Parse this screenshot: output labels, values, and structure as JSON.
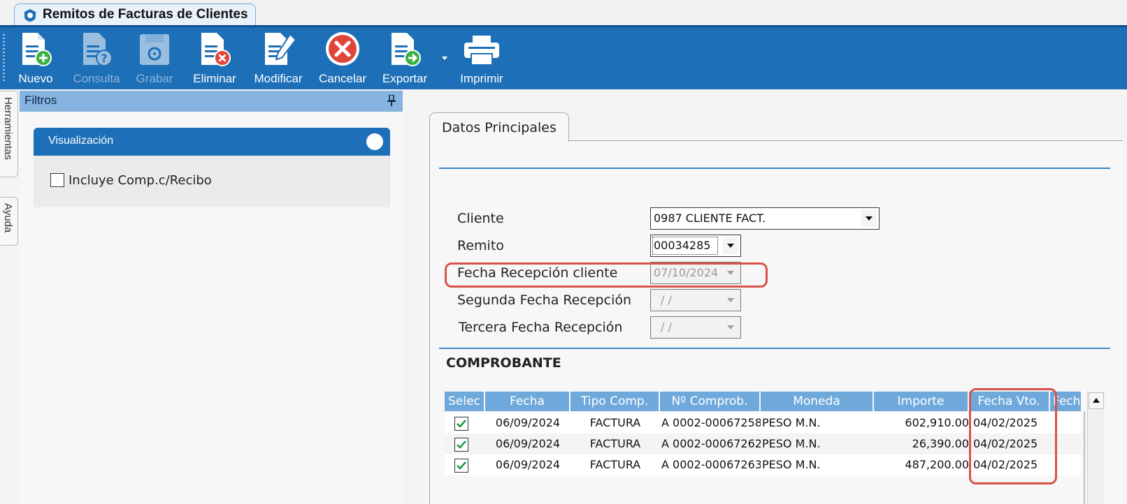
{
  "window": {
    "tab_title": "Remitos de Facturas de Clientes"
  },
  "toolbar": {
    "buttons": [
      {
        "label": "Nuevo",
        "icon": "new-document-icon",
        "enabled": true
      },
      {
        "label": "Consulta",
        "icon": "query-document-icon",
        "enabled": false
      },
      {
        "label": "Grabar",
        "icon": "save-disk-icon",
        "enabled": false
      },
      {
        "label": "Eliminar",
        "icon": "delete-document-icon",
        "enabled": true
      },
      {
        "label": "Modificar",
        "icon": "edit-document-icon",
        "enabled": true
      },
      {
        "label": "Cancelar",
        "icon": "cancel-icon",
        "enabled": true
      },
      {
        "label": "Exportar",
        "icon": "export-document-icon",
        "enabled": true
      },
      {
        "label": "Imprimir",
        "icon": "printer-icon",
        "enabled": true
      }
    ]
  },
  "side_tabs": {
    "herramientas": "Herramientas",
    "ayuda": "Ayuda"
  },
  "filtros": {
    "title": "Filtros",
    "visualizacion": {
      "title": "Visualización",
      "checkbox_label": "Incluye Comp.c/Recibo",
      "checked": false
    }
  },
  "main": {
    "tab_label": "Datos Principales",
    "fields": {
      "cliente_label": "Cliente",
      "cliente_value": "0987 CLIENTE FACT.",
      "remito_label": "Remito",
      "remito_value": "00034285",
      "fecha_recepcion_label": "Fecha Recepción cliente",
      "fecha_recepcion_value": "07/10/2024",
      "segunda_fecha_label": "Segunda Fecha Recepción",
      "segunda_fecha_value": "/ /",
      "tercera_fecha_label": "Tercera Fecha Recepción",
      "tercera_fecha_value": "/ /"
    },
    "comprobante": {
      "title": "COMPROBANTE",
      "columns": [
        "Selec",
        "Fecha",
        "Tipo Comp.",
        "Nº Comprob.",
        "Moneda",
        "Importe",
        "Fecha Vto.",
        "Fech"
      ],
      "rows": [
        {
          "selected": true,
          "fecha": "06/09/2024",
          "tipo": "FACTURA",
          "numero": "A 0002-00067258",
          "moneda": "PESO M.N.",
          "importe": "602,910.00",
          "fecha_vto": "04/02/2025"
        },
        {
          "selected": true,
          "fecha": "06/09/2024",
          "tipo": "FACTURA",
          "numero": "A 0002-00067262",
          "moneda": "PESO M.N.",
          "importe": "26,390.00",
          "fecha_vto": "04/02/2025"
        },
        {
          "selected": true,
          "fecha": "06/09/2024",
          "tipo": "FACTURA",
          "numero": "A 0002-00067263",
          "moneda": "PESO M.N.",
          "importe": "487,200.00",
          "fecha_vto": "04/02/2025"
        }
      ]
    }
  },
  "colors": {
    "toolbar_blue": "#1d6fb8",
    "header_light_blue": "#86b3df",
    "grid_header_blue": "#6fa9dc",
    "highlight_red": "#d9534a",
    "check_green": "#1a9a3a"
  }
}
